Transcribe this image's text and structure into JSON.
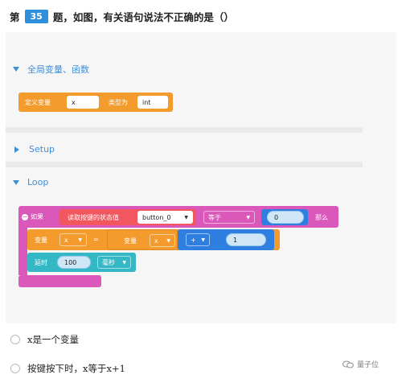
{
  "question": {
    "prefix": "第",
    "number": "35",
    "suffix": "题，如图，有关语句说法不正确的是（）"
  },
  "sections": {
    "globals": {
      "title": "全局变量、函数"
    },
    "setup": {
      "title": "Setup"
    },
    "loop": {
      "title": "Loop"
    }
  },
  "blocks": {
    "define_var": {
      "label": "定义变量",
      "name": "x",
      "type_label": "类型为",
      "type": "int"
    },
    "if_block": {
      "if_label": "如果",
      "read_label": "读取按键的状态值",
      "button": "button_0",
      "compare": "等于",
      "value": "0",
      "then_label": "那么"
    },
    "assign": {
      "var_label": "变量",
      "target": "x",
      "equals": "=",
      "var_label2": "变量",
      "source": "x",
      "operator": "+",
      "operand": "1"
    },
    "delay": {
      "label": "延时",
      "amount": "100",
      "unit": "毫秒"
    }
  },
  "options": [
    {
      "text": "x是一个变量"
    },
    {
      "text": "按键按下时，x等于x+1"
    }
  ],
  "watermark": {
    "text": "量子位"
  },
  "colors": {
    "orange": "#f39b2c",
    "magenta": "#d958b9",
    "red": "#f0575f",
    "blue": "#2f7fe0",
    "teal": "#35b8c6",
    "accent": "#3f8fd8"
  }
}
